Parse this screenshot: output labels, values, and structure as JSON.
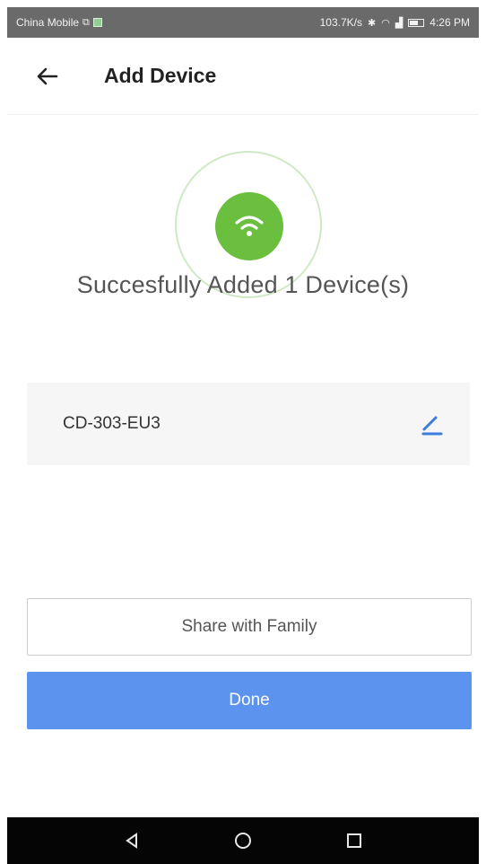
{
  "status_bar": {
    "carrier": "China Mobile",
    "network_speed": "103.7K/s",
    "time": "4:26 PM"
  },
  "header": {
    "title": "Add Device",
    "back_icon": "arrow-left-icon"
  },
  "result": {
    "icon": "wifi-icon",
    "message": "Succesfully Added 1 Device(s)"
  },
  "device": {
    "name": "CD-303-EU3",
    "edit_icon": "pencil-icon"
  },
  "actions": {
    "share_label": "Share with Family",
    "done_label": "Done"
  },
  "colors": {
    "accent_green": "#6bbf3e",
    "primary_blue": "#5b93ee",
    "edit_icon_blue": "#3b7ddd"
  },
  "nav_bar": {
    "icons": [
      "back-triangle-icon",
      "home-circle-icon",
      "recents-square-icon"
    ]
  }
}
